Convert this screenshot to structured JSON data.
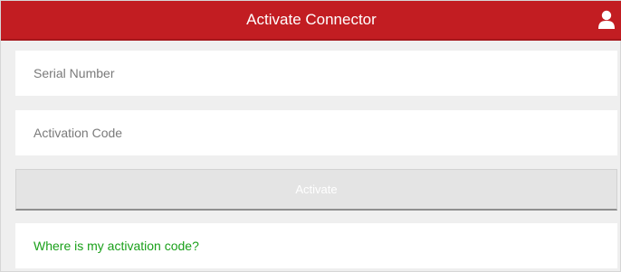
{
  "header": {
    "title": "Activate Connector",
    "user_icon": "user-icon",
    "bg_color": "#c21d22"
  },
  "form": {
    "serial_placeholder": "Serial Number",
    "serial_value": "",
    "activation_placeholder": "Activation Code",
    "activation_value": "",
    "activate_label": "Activate",
    "help_link": "Where is my activation code?",
    "help_link_color": "#1aa01a"
  }
}
